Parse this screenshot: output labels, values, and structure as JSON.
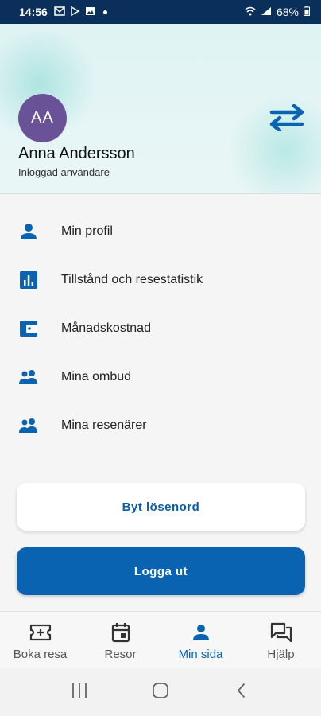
{
  "status_bar": {
    "time": "14:56",
    "battery": "68%"
  },
  "profile": {
    "initials": "AA",
    "name": "Anna Andersson",
    "role": "Inloggad användare",
    "switch_icon": "swap-arrows-icon"
  },
  "menu": {
    "items": [
      {
        "label": "Min profil",
        "icon": "person-icon"
      },
      {
        "label": "Tillstånd och resestatistik",
        "icon": "bar-chart-icon"
      },
      {
        "label": "Månadskostnad",
        "icon": "wallet-icon"
      },
      {
        "label": "Mina ombud",
        "icon": "people-icon"
      },
      {
        "label": "Mina resenärer",
        "icon": "people-icon"
      }
    ]
  },
  "actions": {
    "change_password": "Byt lösenord",
    "logout": "Logga ut"
  },
  "bottom_nav": {
    "tabs": [
      {
        "label": "Boka resa",
        "icon": "ticket-plus-icon",
        "active": false
      },
      {
        "label": "Resor",
        "icon": "calendar-icon",
        "active": false
      },
      {
        "label": "Min sida",
        "icon": "person-icon",
        "active": true
      },
      {
        "label": "Hjälp",
        "icon": "chat-icon",
        "active": false
      }
    ]
  },
  "colors": {
    "primary": "#0a63b0",
    "avatar": "#6a5298",
    "status_bar": "#0b2f5b",
    "header_bg": "#dff3f3"
  }
}
